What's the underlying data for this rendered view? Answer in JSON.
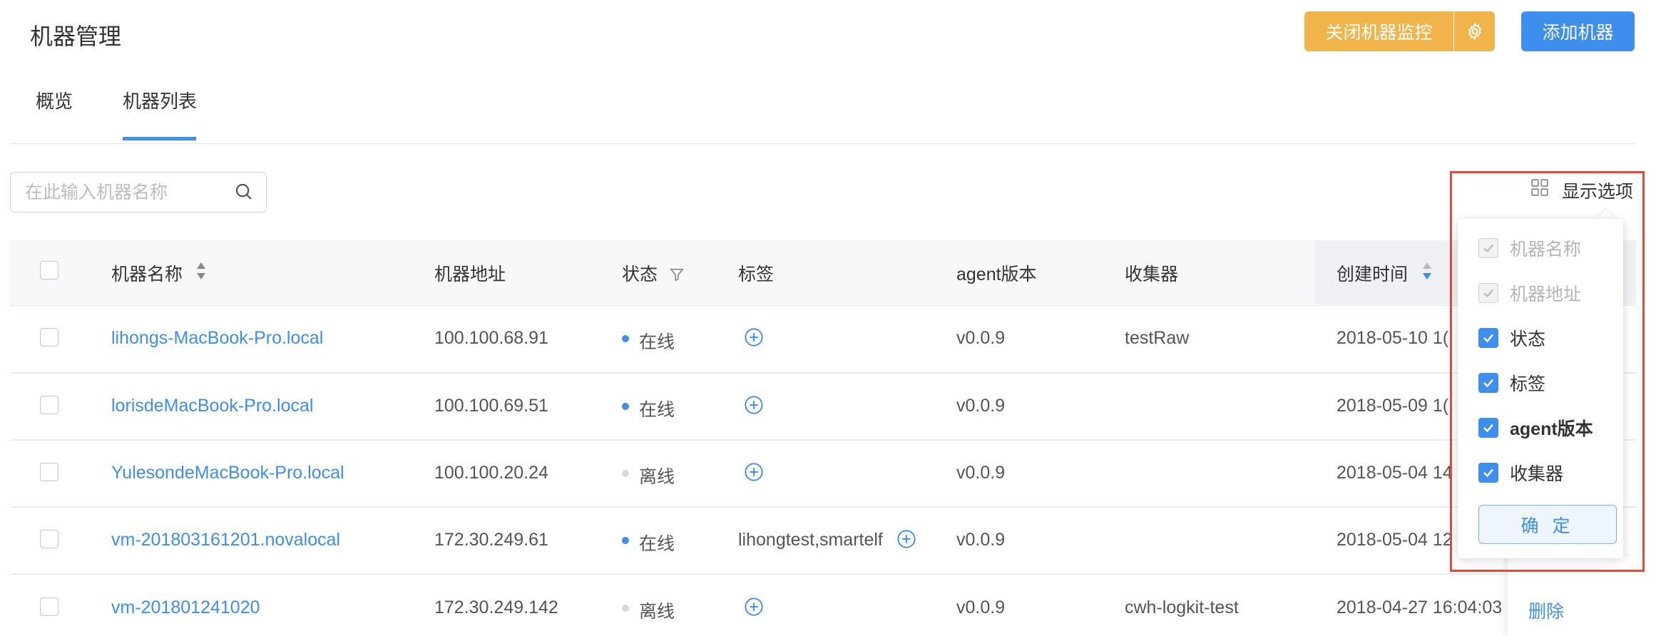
{
  "header": {
    "title": "机器管理",
    "stop_monitor_label": "关闭机器监控",
    "add_machine_label": "添加机器"
  },
  "tabs": [
    {
      "label": "概览",
      "active": false
    },
    {
      "label": "机器列表",
      "active": true
    }
  ],
  "search": {
    "placeholder": "在此输入机器名称",
    "value": ""
  },
  "display_options": {
    "label": "显示选项"
  },
  "columns": {
    "name": "机器名称",
    "address": "机器地址",
    "status": "状态",
    "tags": "标签",
    "agent": "agent版本",
    "collector": "收集器",
    "created": "创建时间"
  },
  "rows": [
    {
      "name": "lihongs-MacBook-Pro.local",
      "address": "100.100.68.91",
      "status": "在线",
      "online": true,
      "tags": "",
      "agent": "v0.0.9",
      "collector": "testRaw",
      "created": "2018-05-10 1("
    },
    {
      "name": "lorisdeMacBook-Pro.local",
      "address": "100.100.69.51",
      "status": "在线",
      "online": true,
      "tags": "",
      "agent": "v0.0.9",
      "collector": "",
      "created": "2018-05-09 1("
    },
    {
      "name": "YulesondeMacBook-Pro.local",
      "address": "100.100.20.24",
      "status": "离线",
      "online": false,
      "tags": "",
      "agent": "v0.0.9",
      "collector": "",
      "created": "2018-05-04 14"
    },
    {
      "name": "vm-201803161201.novalocal",
      "address": "172.30.249.61",
      "status": "在线",
      "online": true,
      "tags": "lihongtest,smartelf",
      "agent": "v0.0.9",
      "collector": "",
      "created": "2018-05-04 12"
    },
    {
      "name": "vm-201801241020",
      "address": "172.30.249.142",
      "status": "离线",
      "online": false,
      "tags": "",
      "agent": "v0.0.9",
      "collector": "cwh-logkit-test",
      "created": "2018-04-27 16:04:03",
      "action": "删除"
    }
  ],
  "popover": {
    "options": [
      {
        "label": "机器名称",
        "checked": true,
        "disabled": true
      },
      {
        "label": "机器地址",
        "checked": true,
        "disabled": true
      },
      {
        "label": "状态",
        "checked": true,
        "disabled": false
      },
      {
        "label": "标签",
        "checked": true,
        "disabled": false
      },
      {
        "label": "agent版本",
        "checked": true,
        "disabled": false
      },
      {
        "label": "收集器",
        "checked": true,
        "disabled": false
      }
    ],
    "confirm_label": "确 定"
  },
  "colors": {
    "accent": "#3d8eed",
    "warning": "#f0b44b",
    "online": "#3d8eed",
    "offline": "#d9d9d9",
    "highlight_border": "#e8453c"
  }
}
